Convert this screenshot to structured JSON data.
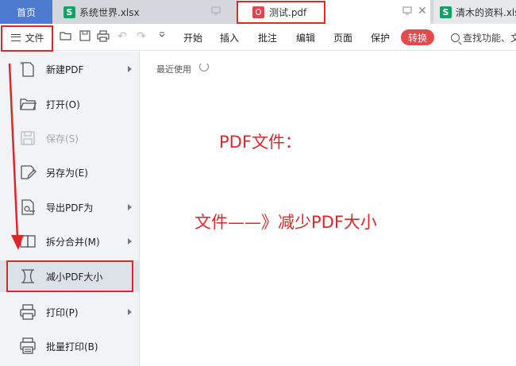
{
  "tabs": {
    "home": "首页",
    "xlsx1": "系统世界.xlsx",
    "xlsx1_icon": "S",
    "pdf": "测试.pdf",
    "xlsx2": "清木的资料.xls",
    "xlsx2_icon": "S"
  },
  "toolbar": {
    "file_label": "文件",
    "menu": [
      "开始",
      "插入",
      "批注",
      "编辑",
      "页面",
      "保护"
    ],
    "convert_label": "转换",
    "search_text": "查找功能、文"
  },
  "file_menu": {
    "items": [
      {
        "label": "新建PDF",
        "icon": "new-pdf-icon",
        "submenu": true,
        "disabled": false
      },
      {
        "label": "打开(O)",
        "icon": "folder-open-icon",
        "submenu": false,
        "disabled": false
      },
      {
        "label": "保存(S)",
        "icon": "save-icon",
        "submenu": false,
        "disabled": true
      },
      {
        "label": "另存为(E)",
        "icon": "save-as-icon",
        "submenu": false,
        "disabled": false
      },
      {
        "label": "导出PDF为",
        "icon": "export-pdf-icon",
        "submenu": true,
        "disabled": false
      },
      {
        "label": "拆分合并(M)",
        "icon": "split-merge-icon",
        "submenu": true,
        "disabled": false
      },
      {
        "label": "减小PDF大小",
        "icon": "compress-icon",
        "submenu": false,
        "disabled": false,
        "selected": true
      },
      {
        "label": "打印(P)",
        "icon": "print-icon",
        "submenu": true,
        "disabled": false
      },
      {
        "label": "批量打印(B)",
        "icon": "batch-print-icon",
        "submenu": false,
        "disabled": false
      }
    ]
  },
  "main": {
    "recent_label": "最近使用"
  },
  "annotations": {
    "line1": "PDF文件：",
    "line2": "文件——》减少PDF大小",
    "color": "#e0262a"
  },
  "colors": {
    "accent_blue": "#4d7bd0",
    "convert_red": "#e5484d",
    "xls_green": "#16a067",
    "pdf_red": "#e0454b"
  }
}
